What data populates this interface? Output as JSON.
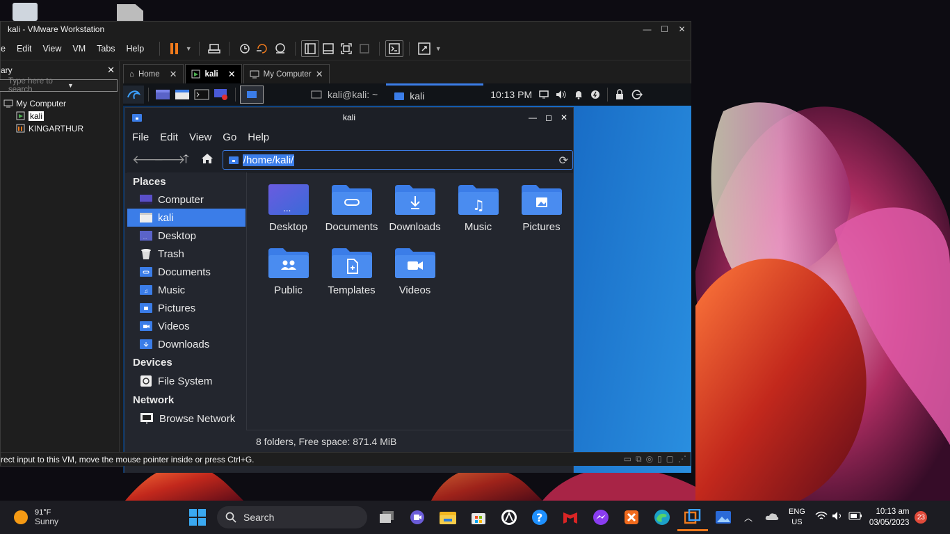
{
  "vmware": {
    "title": "kali - VMware Workstation",
    "menu": [
      "e",
      "Edit",
      "View",
      "VM",
      "Tabs",
      "Help"
    ],
    "library": {
      "header": "ary",
      "search_placeholder": "Type here to search",
      "tree": {
        "root": "My Computer",
        "vm1": "kali",
        "vm2": "KINGARTHUR"
      }
    },
    "tabs": [
      {
        "label": "Home"
      },
      {
        "label": "kali"
      },
      {
        "label": "My Computer"
      }
    ],
    "status_text": "rect input to this VM, move the mouse pointer inside or press Ctrl+G."
  },
  "kali_panel": {
    "task_terminal": "kali@kali: ~",
    "task_files": "kali",
    "clock": "10:13 PM"
  },
  "thunar": {
    "title": "kali",
    "menu": [
      "File",
      "Edit",
      "View",
      "Go",
      "Help"
    ],
    "location": "/home/kali/",
    "sidebar": {
      "places_header": "Places",
      "places": [
        "Computer",
        "kali",
        "Desktop",
        "Trash",
        "Documents",
        "Music",
        "Pictures",
        "Videos",
        "Downloads"
      ],
      "devices_header": "Devices",
      "devices": [
        "File System"
      ],
      "network_header": "Network",
      "network": [
        "Browse Network"
      ]
    },
    "folders": [
      "Desktop",
      "Documents",
      "Downloads",
      "Music",
      "Pictures",
      "Public",
      "Templates",
      "Videos"
    ],
    "status": "8 folders, Free space: 871.4 MiB"
  },
  "taskbar": {
    "weather_temp": "91°F",
    "weather_desc": "Sunny",
    "search_label": "Search",
    "lang_1": "ENG",
    "lang_2": "US",
    "time": "10:13 am",
    "date": "03/05/2023",
    "notif_count": "23"
  },
  "colors": {
    "accent": "#3b7de8",
    "folder": "#3b7de8"
  }
}
